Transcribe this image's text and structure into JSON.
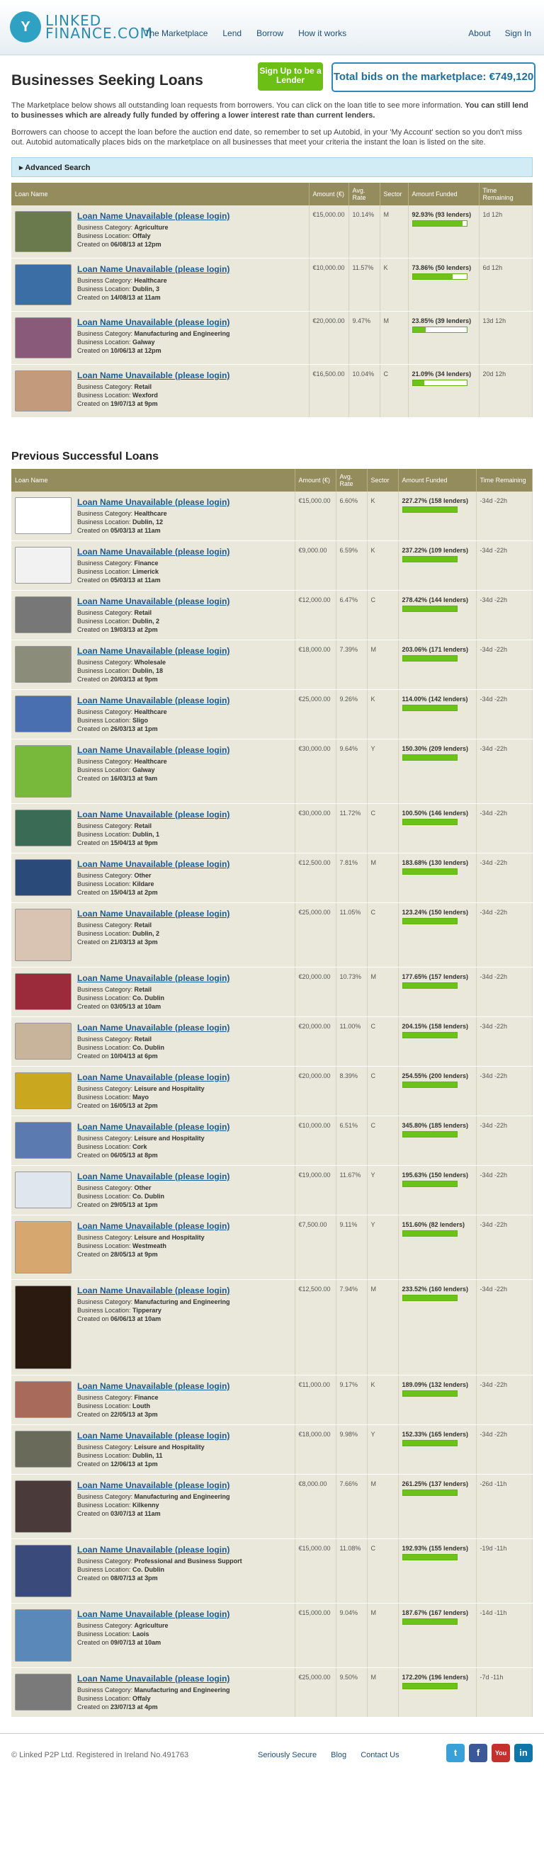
{
  "header": {
    "logo_text": [
      "LINKED",
      "FINANCE.COM"
    ],
    "logo_mark": "Y",
    "nav_left": [
      "The Marketplace",
      "Lend",
      "Borrow",
      "How it works"
    ],
    "nav_right": [
      "About",
      "Sign In"
    ]
  },
  "title": "Businesses Seeking Loans",
  "signup_label": "Sign Up to be a Lender",
  "total_bids": "Total bids on the marketplace: €749,120",
  "intro1": "The Marketplace below shows all outstanding loan requests from borrowers. You can click on the loan title to see more information.",
  "intro1_bold": "You can still lend to businesses which are already fully funded by offering a lower interest rate than current lenders.",
  "intro2": "Borrowers can choose to accept the loan before the auction end date, so remember to set up Autobid, in your 'My Account' section so you don't miss out. Autobid automatically places bids on the marketplace on all businesses that meet your criteria the instant the loan is listed on the site.",
  "advanced_search": "Advanced Search",
  "columns": [
    "Loan Name",
    "Amount (€)",
    "Avg. Rate",
    "Sector",
    "Amount Funded",
    "Time Remaining"
  ],
  "active_loans": [
    {
      "title": "Loan Name Unavailable (please login)",
      "category": "Agriculture",
      "location": "Offaly",
      "created": "06/08/13 at 12pm",
      "amount": "€15,000.00",
      "rate": "10.14%",
      "sector": "M",
      "funded": "92.93% (93 lenders)",
      "funded_pct": 92.93,
      "time": "1d 12h",
      "thumb": "#6b7a4d"
    },
    {
      "title": "Loan Name Unavailable (please login)",
      "category": "Healthcare",
      "location": "Dublin, 3",
      "created": "14/08/13 at 11am",
      "amount": "€10,000.00",
      "rate": "11.57%",
      "sector": "K",
      "funded": "73.86% (50 lenders)",
      "funded_pct": 73.86,
      "time": "6d 12h",
      "thumb": "#3a6ea5"
    },
    {
      "title": "Loan Name Unavailable (please login)",
      "category": "Manufacturing and Engineering",
      "location": "Galway",
      "created": "10/06/13 at 12pm",
      "amount": "€20,000.00",
      "rate": "9.47%",
      "sector": "M",
      "funded": "23.85% (39 lenders)",
      "funded_pct": 23.85,
      "time": "13d 12h",
      "thumb": "#8a5a7a"
    },
    {
      "title": "Loan Name Unavailable (please login)",
      "category": "Retail",
      "location": "Wexford",
      "created": "19/07/13 at 9pm",
      "amount": "€16,500.00",
      "rate": "10.04%",
      "sector": "C",
      "funded": "21.09% (34 lenders)",
      "funded_pct": 21.09,
      "time": "20d 12h",
      "thumb": "#c49a7c"
    }
  ],
  "previous_title": "Previous Successful Loans",
  "previous_loans": [
    {
      "category": "Healthcare",
      "location": "Dublin, 12",
      "created": "05/03/13 at 11am",
      "amount": "€15,000.00",
      "rate": "6.60%",
      "sector": "K",
      "funded": "227.27% (158 lenders)",
      "time": "-34d -22h",
      "thumb": "#ffffff"
    },
    {
      "category": "Finance",
      "location": "Limerick",
      "created": "05/03/13 at 11am",
      "amount": "€9,000.00",
      "rate": "6.59%",
      "sector": "K",
      "funded": "237.22% (109 lenders)",
      "time": "-34d -22h",
      "thumb": "#f2f2f2"
    },
    {
      "category": "Retail",
      "location": "Dublin, 2",
      "created": "19/03/13 at 2pm",
      "amount": "€12,000.00",
      "rate": "6.47%",
      "sector": "C",
      "funded": "278.42% (144 lenders)",
      "time": "-34d -22h",
      "thumb": "#777777"
    },
    {
      "category": "Wholesale",
      "location": "Dublin, 18",
      "created": "20/03/13 at 9pm",
      "amount": "€18,000.00",
      "rate": "7.39%",
      "sector": "M",
      "funded": "203.06% (171 lenders)",
      "time": "-34d -22h",
      "thumb": "#8c8c7a"
    },
    {
      "category": "Healthcare",
      "location": "Sligo",
      "created": "26/03/13 at 1pm",
      "amount": "€25,000.00",
      "rate": "9.26%",
      "sector": "K",
      "funded": "114.00% (142 lenders)",
      "time": "-34d -22h",
      "thumb": "#4a6fb0"
    },
    {
      "category": "Healthcare",
      "location": "Galway",
      "created": "16/03/13 at 9am",
      "amount": "€30,000.00",
      "rate": "9.64%",
      "sector": "Y",
      "funded": "150.30% (209 lenders)",
      "time": "-34d -22h",
      "thumb": "#78b83a"
    },
    {
      "category": "Retail",
      "location": "Dublin, 1",
      "created": "15/04/13 at 9pm",
      "amount": "€30,000.00",
      "rate": "11.72%",
      "sector": "C",
      "funded": "100.50% (146 lenders)",
      "time": "-34d -22h",
      "thumb": "#3a6b55"
    },
    {
      "category": "Other",
      "location": "Kildare",
      "created": "15/04/13 at 2pm",
      "amount": "€12,500.00",
      "rate": "7.81%",
      "sector": "M",
      "funded": "183.68% (130 lenders)",
      "time": "-34d -22h",
      "thumb": "#2a4a7a"
    },
    {
      "category": "Retail",
      "location": "Dublin, 2",
      "created": "21/03/13 at 3pm",
      "amount": "€25,000.00",
      "rate": "11.05%",
      "sector": "C",
      "funded": "123.24% (150 lenders)",
      "time": "-34d -22h",
      "thumb": "#d9c4b4"
    },
    {
      "category": "Retail",
      "location": "Co. Dublin",
      "created": "03/05/13 at 10am",
      "amount": "€20,000.00",
      "rate": "10.73%",
      "sector": "M",
      "funded": "177.65% (157 lenders)",
      "time": "-34d -22h",
      "thumb": "#9b2a3a"
    },
    {
      "category": "Retail",
      "location": "Co. Dublin",
      "created": "10/04/13 at 6pm",
      "amount": "€20,000.00",
      "rate": "11.00%",
      "sector": "C",
      "funded": "204.15% (158 lenders)",
      "time": "-34d -22h",
      "thumb": "#c8b49a"
    },
    {
      "category": "Leisure and Hospitality",
      "location": "Mayo",
      "created": "16/05/13 at 2pm",
      "amount": "€20,000.00",
      "rate": "8.39%",
      "sector": "C",
      "funded": "254.55% (200 lenders)",
      "time": "-34d -22h",
      "thumb": "#c9a820"
    },
    {
      "category": "Leisure and Hospitality",
      "location": "Cork",
      "created": "06/05/13 at 8pm",
      "amount": "€10,000.00",
      "rate": "6.51%",
      "sector": "C",
      "funded": "345.80% (185 lenders)",
      "time": "-34d -22h",
      "thumb": "#5a7ab0"
    },
    {
      "category": "Other",
      "location": "Co. Dublin",
      "created": "29/05/13 at 1pm",
      "amount": "€19,000.00",
      "rate": "11.67%",
      "sector": "Y",
      "funded": "195.63% (150 lenders)",
      "time": "-34d -22h",
      "thumb": "#e0e6ee"
    },
    {
      "category": "Leisure and Hospitality",
      "location": "Westmeath",
      "created": "28/05/13 at 9pm",
      "amount": "€7,500.00",
      "rate": "9.11%",
      "sector": "Y",
      "funded": "151.60% (82 lenders)",
      "time": "-34d -22h",
      "thumb": "#d6a870"
    },
    {
      "category": "Manufacturing and Engineering",
      "location": "Tipperary",
      "created": "06/06/13 at 10am",
      "amount": "€12,500.00",
      "rate": "7.94%",
      "sector": "M",
      "funded": "233.52% (160 lenders)",
      "time": "-34d -22h",
      "thumb": "#2a1a10"
    },
    {
      "category": "Finance",
      "location": "Louth",
      "created": "22/05/13 at 3pm",
      "amount": "€11,000.00",
      "rate": "9.17%",
      "sector": "K",
      "funded": "189.09% (132 lenders)",
      "time": "-34d -22h",
      "thumb": "#a86a5a"
    },
    {
      "category": "Leisure and Hospitality",
      "location": "Dublin, 11",
      "created": "12/06/13 at 1pm",
      "amount": "€18,000.00",
      "rate": "9.98%",
      "sector": "Y",
      "funded": "152.33% (165 lenders)",
      "time": "-34d -22h",
      "thumb": "#6a6a5a"
    },
    {
      "category": "Manufacturing and Engineering",
      "location": "Kilkenny",
      "created": "03/07/13 at 11am",
      "amount": "€8,000.00",
      "rate": "7.66%",
      "sector": "M",
      "funded": "261.25% (137 lenders)",
      "time": "-26d -11h",
      "thumb": "#4a3a3a"
    },
    {
      "category": "Professional and Business Support",
      "location": "Co. Dublin",
      "created": "08/07/13 at 3pm",
      "amount": "€15,000.00",
      "rate": "11.08%",
      "sector": "C",
      "funded": "192.93% (155 lenders)",
      "time": "-19d -11h",
      "thumb": "#3a4a7a"
    },
    {
      "category": "Agriculture",
      "location": "Laois",
      "created": "09/07/13 at 10am",
      "amount": "€15,000.00",
      "rate": "9.04%",
      "sector": "M",
      "funded": "187.67% (167 lenders)",
      "time": "-14d -11h",
      "thumb": "#5a88b8"
    },
    {
      "category": "Manufacturing and Engineering",
      "location": "Offaly",
      "created": "23/07/13 at 4pm",
      "amount": "€25,000.00",
      "rate": "9.50%",
      "sector": "M",
      "funded": "172.20% (196 lenders)",
      "time": "-7d -11h",
      "thumb": "#7a7a7a"
    }
  ],
  "row_title": "Loan Name Unavailable (please login)",
  "labels": {
    "category": "Business Category: ",
    "location": "Business Location: ",
    "created": "Created on "
  },
  "footer": {
    "copyright": "© Linked P2P Ltd. Registered in Ireland No.491763",
    "links": [
      "Seriously Secure",
      "Blog",
      "Contact Us"
    ],
    "social": [
      {
        "name": "twitter-icon",
        "glyph": "t",
        "color": "#3aa0d8"
      },
      {
        "name": "facebook-icon",
        "glyph": "f",
        "color": "#3b5998"
      },
      {
        "name": "youtube-icon",
        "glyph": "You",
        "color": "#c4302b"
      },
      {
        "name": "linkedin-icon",
        "glyph": "in",
        "color": "#0e76a8"
      }
    ]
  }
}
